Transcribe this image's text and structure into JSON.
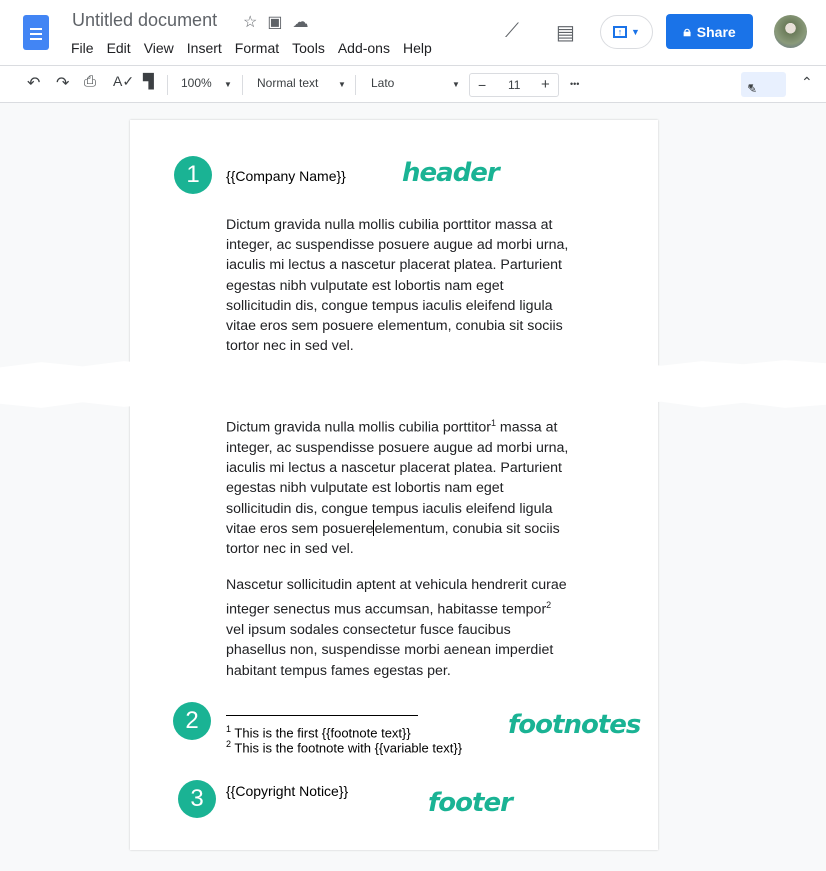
{
  "app": {
    "title": "Untitled document",
    "menu": [
      "File",
      "Edit",
      "View",
      "Insert",
      "Format",
      "Tools",
      "Add-ons",
      "Help"
    ],
    "share_label": "Share"
  },
  "toolbar": {
    "zoom": "100%",
    "style": "Normal text",
    "font": "Lato",
    "font_size": "11",
    "minus": "−",
    "plus": "+",
    "more": "•••"
  },
  "doc": {
    "header": "{{Company Name}}",
    "para1": "Dictum gravida nulla mollis cubilia porttitor massa at integer, ac suspendisse posuere augue ad morbi urna, iaculis mi lectus a nascetur placerat platea. Parturient egestas nibh vulputate est lobortis nam eget sollicitudin dis, congue tempus iaculis eleifend ligula vitae eros sem posuere elementum, conubia sit sociis tortor nec in sed vel.",
    "para2a": "Dictum gravida nulla mollis cubilia porttitor",
    "sup1": "1",
    "para2b": " massa at integer, ac suspendisse posuere augue ad morbi urna, iaculis mi lectus a nascetur placerat platea. Parturient egestas nibh vulputate est lobortis nam eget sollicitudin dis, congue tempus iaculis eleifend ligula vitae eros sem posuere",
    "para2c": "elementum, conubia sit sociis tortor nec in sed vel.",
    "para3a": "Nascetur sollicitudin aptent at vehicula hendrerit curae integer senectus mus accumsan, habitasse tempor",
    "sup2": "2",
    "para3b": " vel ipsum sodales consectetur fusce faucibus phasellus non, suspendisse morbi aenean imperdiet habitant tempus fames egestas per.",
    "fn1_num": "1",
    "fn1": " This is the first {{footnote text}}",
    "fn2_num": "2",
    "fn2": " This is the footnote with {{variable text}}",
    "footer": "{{Copyright Notice}}"
  },
  "annotations": {
    "b1": "1",
    "b2": "2",
    "b3": "3",
    "header": "header",
    "footnotes": "footnotes",
    "footer": "footer",
    "color": "#1ab394"
  }
}
